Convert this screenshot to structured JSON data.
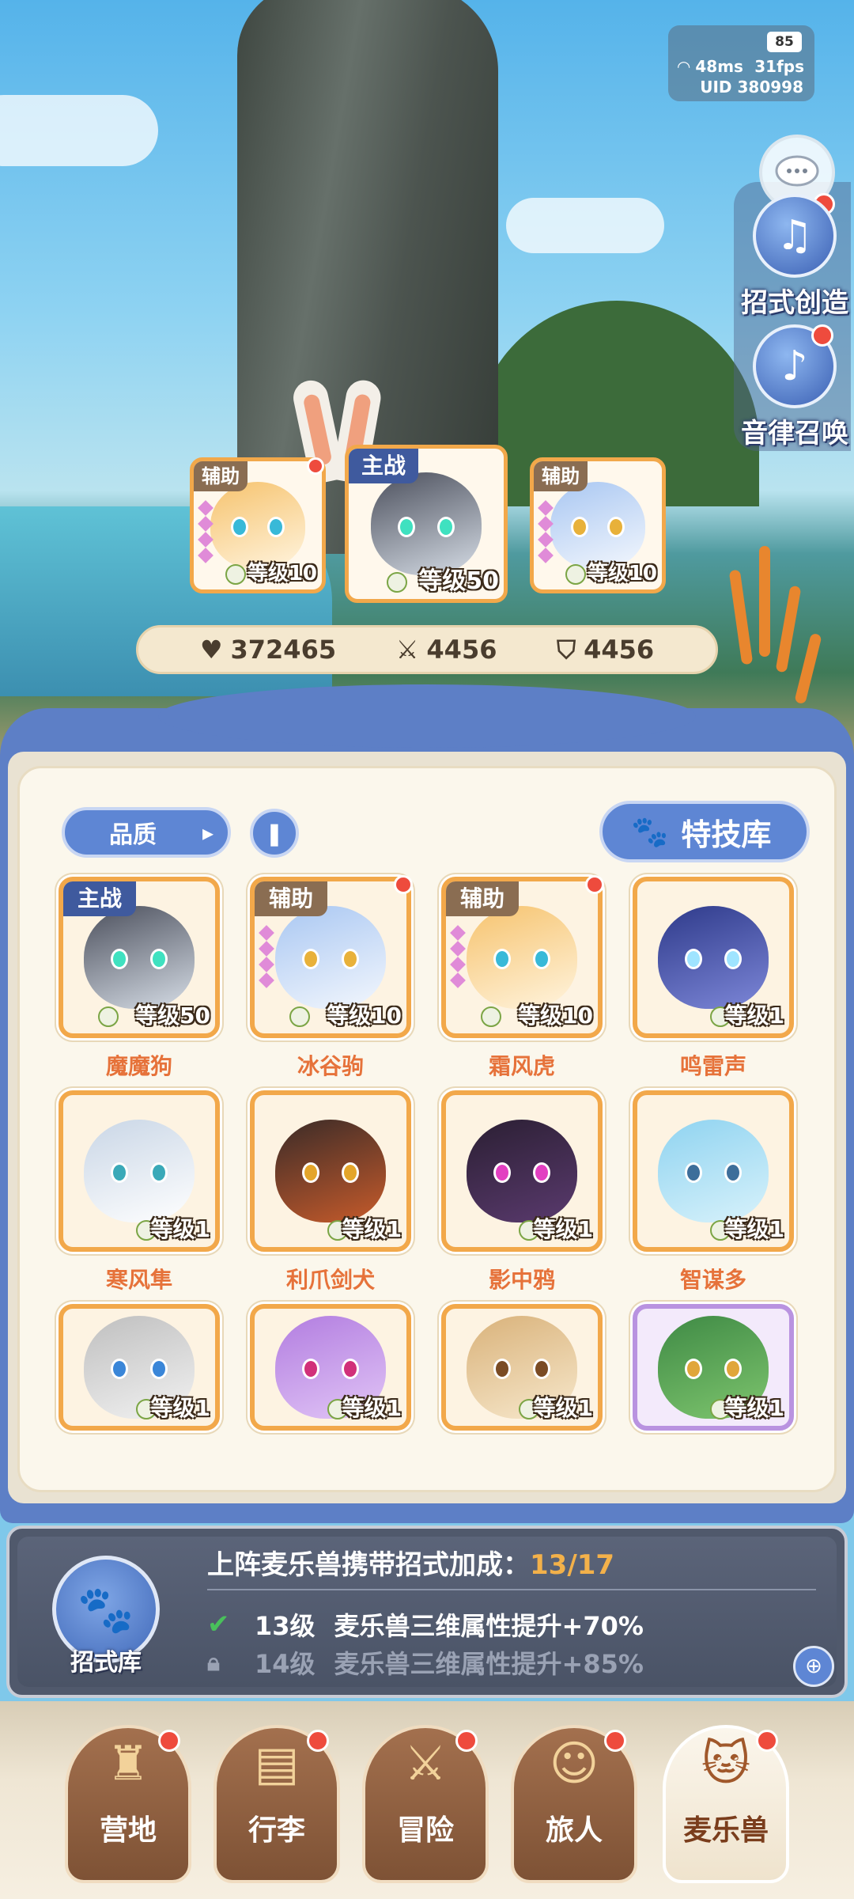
{
  "hud": {
    "battery": "85",
    "ping": "48ms",
    "fps": "31fps",
    "uid": "UID 380998"
  },
  "side": {
    "skill_create_label": "招式创造",
    "summon_label": "音律召唤"
  },
  "team": [
    {
      "tag": "辅助",
      "level": "等级10",
      "accent": "#f2a84a"
    },
    {
      "tag": "主战",
      "level": "等级50",
      "accent": "#f2a84a"
    },
    {
      "tag": "辅助",
      "level": "等级10",
      "accent": "#f2a84a"
    }
  ],
  "stats": {
    "hp": "372465",
    "attack": "4456",
    "defense": "4456"
  },
  "filters": {
    "quality_label": "品质",
    "skill_library_label": "特技库"
  },
  "pets": [
    {
      "name": "魔魔狗",
      "tag": "主战",
      "level": "等级50"
    },
    {
      "name": "冰谷驹",
      "tag": "辅助",
      "level": "等级10"
    },
    {
      "name": "霜风虎",
      "tag": "辅助",
      "level": "等级10"
    },
    {
      "name": "鸣雷声",
      "tag": "",
      "level": "等级1"
    },
    {
      "name": "寒风隼",
      "tag": "",
      "level": "等级1"
    },
    {
      "name": "利爪剑犬",
      "tag": "",
      "level": "等级1"
    },
    {
      "name": "影中鸦",
      "tag": "",
      "level": "等级1"
    },
    {
      "name": "智谋多",
      "tag": "",
      "level": "等级1"
    },
    {
      "name": "",
      "tag": "",
      "level": "等级1"
    },
    {
      "name": "",
      "tag": "",
      "level": "等级1"
    },
    {
      "name": "",
      "tag": "",
      "level": "等级1"
    },
    {
      "name": "",
      "tag": "",
      "level": "等级1"
    }
  ],
  "bonus": {
    "badge_label": "招式库",
    "title": "上阵麦乐兽携带招式加成：",
    "count": "13/17",
    "current_level": "13级",
    "current_text": "麦乐兽三维属性提升+70%",
    "next_level": "14级",
    "next_text": "麦乐兽三维属性提升+85%"
  },
  "nav": [
    {
      "label": "营地",
      "icon": "castle-icon"
    },
    {
      "label": "行李",
      "icon": "backpack-icon"
    },
    {
      "label": "冒险",
      "icon": "crossed-swords-icon"
    },
    {
      "label": "旅人",
      "icon": "traveler-icon"
    },
    {
      "label": "麦乐兽",
      "icon": "pet-cat-icon"
    }
  ],
  "colors": {
    "card_border": "#f2a84a",
    "rare_border": "#b993e0",
    "panel_blue": "#5d7fc6",
    "name_orange": "#e6723a",
    "bonus_count": "#f3b14a",
    "red_dot": "#ee4b3d"
  }
}
